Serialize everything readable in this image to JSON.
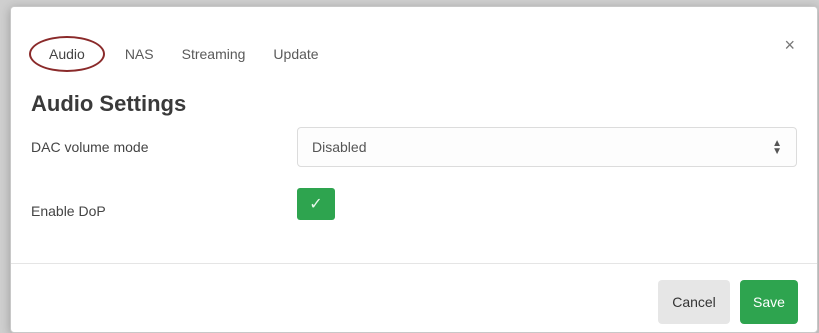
{
  "tabs": [
    {
      "label": "Audio",
      "active": true
    },
    {
      "label": "NAS",
      "active": false
    },
    {
      "label": "Streaming",
      "active": false
    },
    {
      "label": "Update",
      "active": false
    }
  ],
  "close_glyph": "×",
  "section_title": "Audio Settings",
  "dac_volume": {
    "label": "DAC volume mode",
    "selected": "Disabled"
  },
  "dop": {
    "label": "Enable DoP",
    "checked": true
  },
  "footer": {
    "cancel_label": "Cancel",
    "save_label": "Save"
  },
  "colors": {
    "accent_green": "#2ea44f",
    "highlight_circle": "#8a2a2a"
  }
}
